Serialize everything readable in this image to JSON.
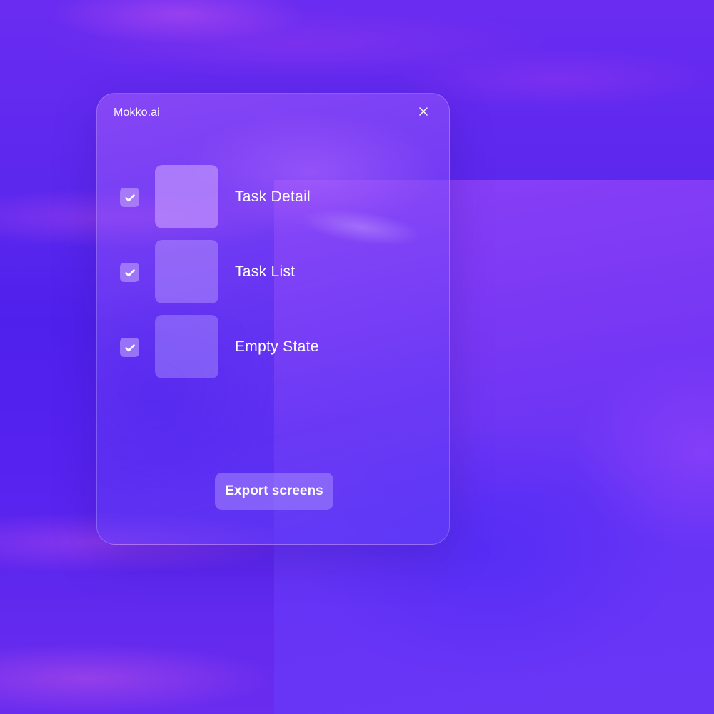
{
  "window": {
    "title": "Mokko.ai",
    "close_icon": "close-icon"
  },
  "screens": [
    {
      "label": "Task Detail",
      "checked": true
    },
    {
      "label": "Task List",
      "checked": true
    },
    {
      "label": "Empty State",
      "checked": true
    }
  ],
  "actions": {
    "export_label": "Export screens"
  },
  "colors": {
    "background": "#5a27ee",
    "accent": "#8a40f6",
    "text": "#ffffff"
  }
}
